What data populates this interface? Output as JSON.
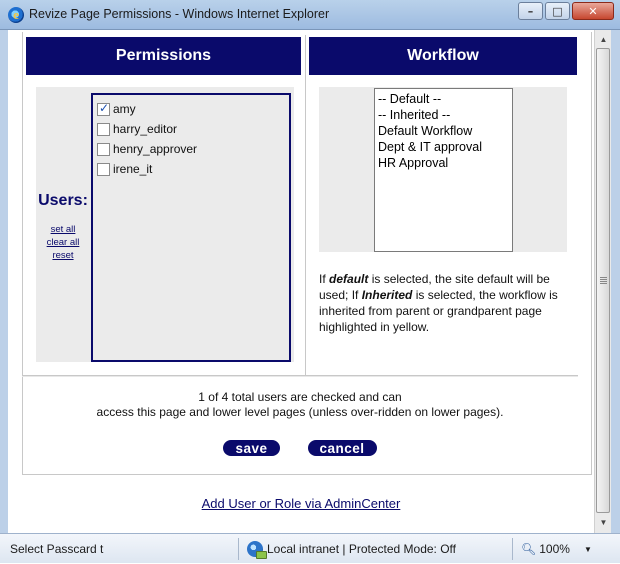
{
  "window": {
    "title": "Revize Page Permissions - Windows Internet Explorer",
    "minimize": "–",
    "maximize": "□",
    "close": "✕"
  },
  "permissions": {
    "header": "Permissions",
    "users_label": "Users:",
    "links": [
      "set all",
      "clear all",
      "reset"
    ],
    "users": [
      {
        "name": "amy",
        "checked": true
      },
      {
        "name": "harry_editor",
        "checked": false
      },
      {
        "name": "henry_approver",
        "checked": false
      },
      {
        "name": "irene_it",
        "checked": false
      }
    ]
  },
  "workflow": {
    "header": "Workflow",
    "options": [
      "-- Default --",
      "-- Inherited --",
      "Default Workflow",
      "Dept & IT approval",
      "HR Approval"
    ],
    "note_parts": {
      "p1": "If ",
      "default": "default",
      "p2": " is selected, the site default will be used; If ",
      "inherited": "Inherited",
      "p3": " is selected, the workflow is inherited from parent or grandparent page highlighted in yellow."
    }
  },
  "status": {
    "line1": "1 of 4 total users are checked and can",
    "line2": "access this page and lower level pages (unless over-ridden on lower pages)."
  },
  "buttons": {
    "save": "save",
    "cancel": "cancel"
  },
  "admin_link": "Add User or Role via AdminCenter",
  "statusbar": {
    "left_text": "Select Passcard t",
    "zone": "Local intranet | Protected Mode: Off",
    "zoom": "100%",
    "zoom_arrow": "▼"
  }
}
